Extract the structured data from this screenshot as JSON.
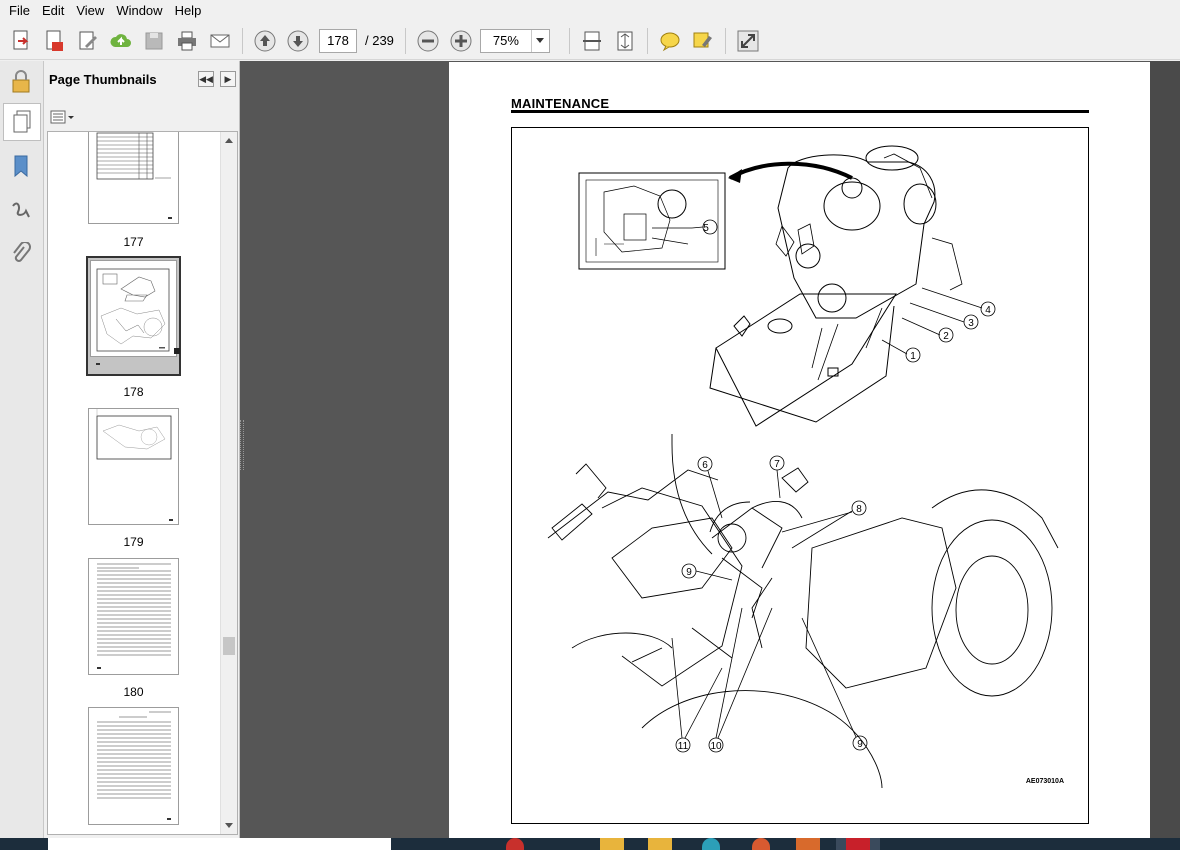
{
  "menu": [
    "File",
    "Edit",
    "View",
    "Window",
    "Help"
  ],
  "toolbar": {
    "current_page": "178",
    "total_pages": "/ 239",
    "zoom": "75%"
  },
  "panel": {
    "title": "Page Thumbnails"
  },
  "thumbnails": [
    {
      "page": "177"
    },
    {
      "page": "178",
      "selected": true
    },
    {
      "page": "179"
    },
    {
      "page": "180"
    }
  ],
  "document": {
    "heading": "MAINTENANCE",
    "figure_code": "AE073010A",
    "callouts": [
      "1",
      "2",
      "3",
      "4",
      "5",
      "6",
      "7",
      "8",
      "9",
      "9",
      "10",
      "11"
    ]
  },
  "colors": {
    "doc_background": "#565656",
    "accent_blue": "#2a63b8",
    "selected_thumb_bg": "#c4c4c4"
  }
}
